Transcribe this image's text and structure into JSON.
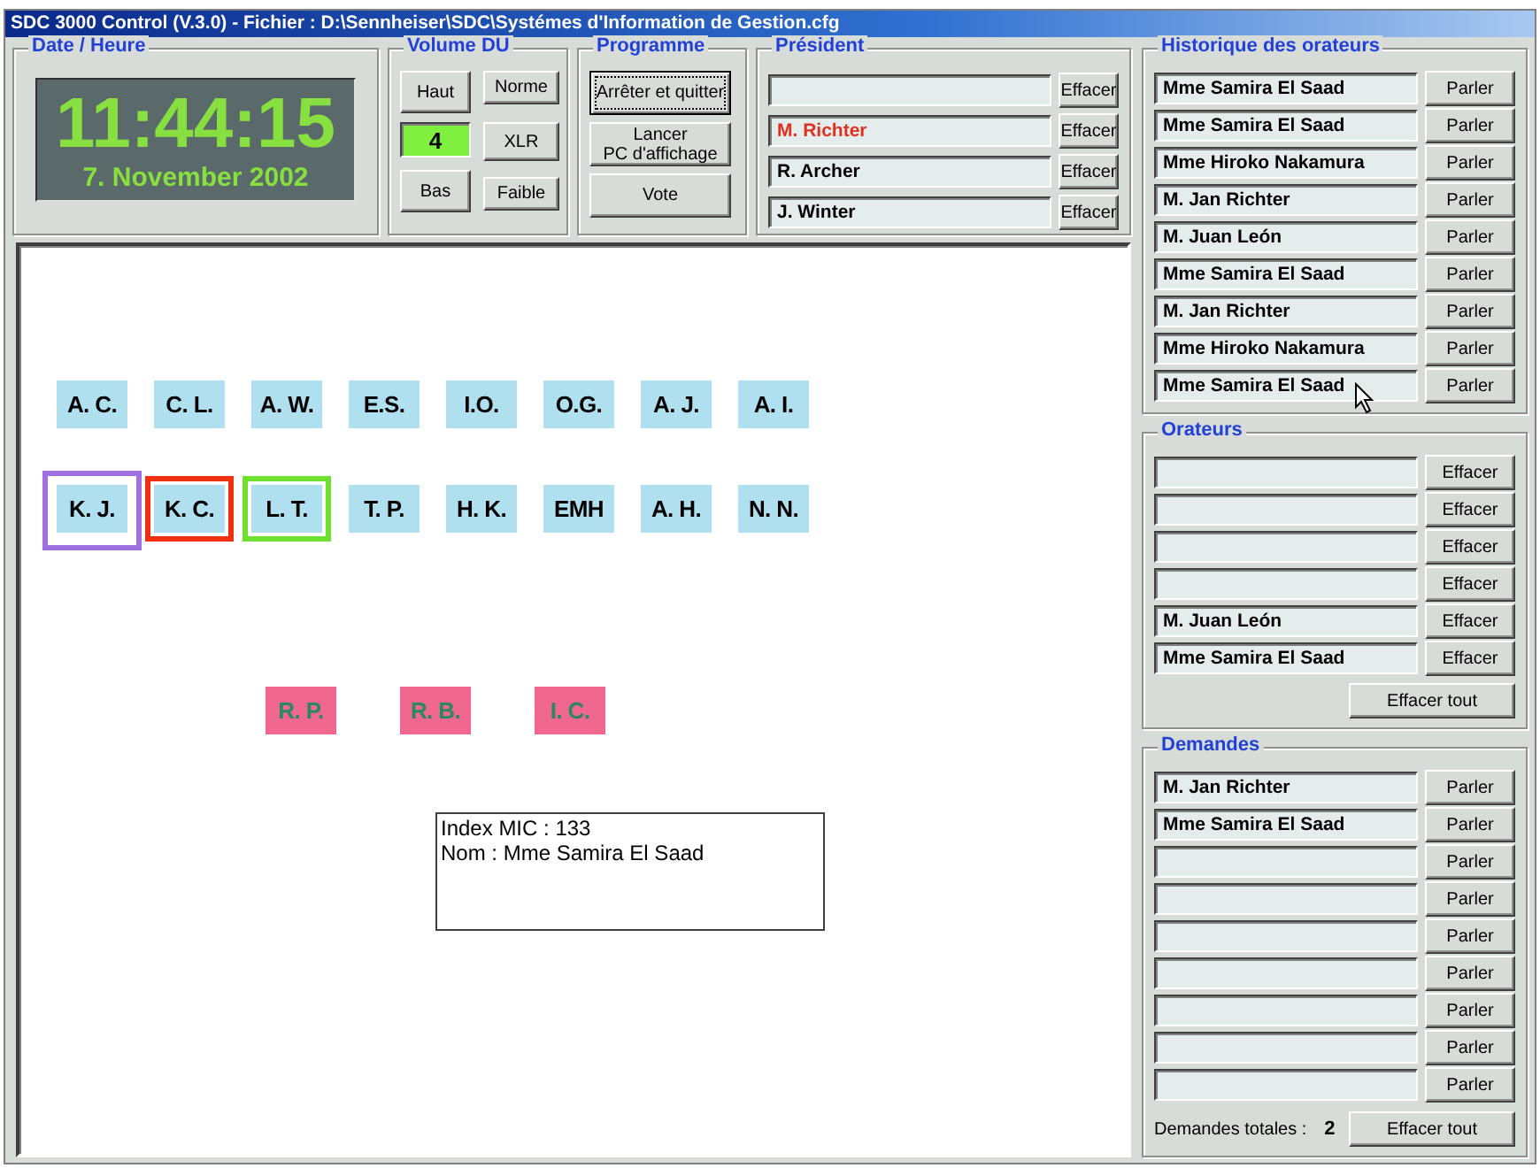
{
  "window": {
    "title": "SDC 3000 Control (V.3.0) - Fichier : D:\\Sennheiser\\SDC\\Systémes d'Information de Gestion.cfg"
  },
  "date_time": {
    "title": "Date / Heure",
    "time": "11:44:15",
    "date": "7. November 2002"
  },
  "volume": {
    "title": "Volume DU",
    "up": "Haut",
    "down": "Bas",
    "value": "4",
    "modes": [
      "Norme",
      "XLR",
      "Faible"
    ]
  },
  "program": {
    "title": "Programme",
    "buttons": [
      {
        "label": "Arrêter et quitter",
        "focused": true
      },
      {
        "label": "Lancer\nPC d'affichage",
        "focused": false
      },
      {
        "label": "Vote",
        "focused": false
      }
    ]
  },
  "president": {
    "title": "Président",
    "rows": [
      {
        "name": "",
        "button": "Effacer"
      },
      {
        "name": "M. Richter",
        "color": "#e03020",
        "button": "Effacer"
      },
      {
        "name": "R. Archer",
        "color": "#000000",
        "button": "Effacer"
      },
      {
        "name": "J. Winter",
        "color": "#000000",
        "button": "Effacer"
      }
    ]
  },
  "mic_rows": [
    {
      "mics": [
        {
          "label": "A. C.",
          "color": "#b0e0f0"
        },
        {
          "label": "C. L.",
          "color": "#b0e0f0"
        },
        {
          "label": "A. W.",
          "color": "#b0e0f0"
        },
        {
          "label": "E.S.",
          "color": "#b0e0f0"
        },
        {
          "label": "I.O.",
          "color": "#b0e0f0"
        },
        {
          "label": "O.G.",
          "color": "#b0e0f0"
        },
        {
          "label": "A. J.",
          "color": "#b0e0f0"
        },
        {
          "label": "A. I.",
          "color": "#b0e0f0"
        }
      ]
    },
    {
      "mics": [
        {
          "label": "K. J.",
          "color": "#b0e0f0",
          "outline": {
            "color": "#a070e0"
          }
        },
        {
          "label": "K. C.",
          "color": "#b0e0f0",
          "outline": {
            "color": "#f03010"
          }
        },
        {
          "label": "L. T.",
          "color": "#b0e0f0",
          "outline": {
            "color": "#70e030"
          }
        },
        {
          "label": "T. P.",
          "color": "#b0e0f0"
        },
        {
          "label": "H. K.",
          "color": "#b0e0f0"
        },
        {
          "label": "EMH",
          "color": "#b0e0f0"
        },
        {
          "label": "A. H.",
          "color": "#b0e0f0"
        },
        {
          "label": "N. N.",
          "color": "#b0e0f0"
        }
      ]
    },
    {
      "mics": [
        {
          "label": "R. P.",
          "color": "#f06890"
        },
        {
          "label": "R. B.",
          "color": "#f06890"
        },
        {
          "label": "I. C.",
          "color": "#f06890"
        }
      ]
    }
  ],
  "info": {
    "lines": [
      "Index MIC : 133",
      "Nom : Mme Samira El Saad"
    ]
  },
  "history": {
    "title": "Historique des orateurs",
    "rows": [
      {
        "name": "Mme Samira El Saad",
        "button": "Parler"
      },
      {
        "name": "Mme Samira El Saad",
        "button": "Parler"
      },
      {
        "name": "Mme Hiroko Nakamura",
        "button": "Parler"
      },
      {
        "name": "M. Jan Richter",
        "button": "Parler"
      },
      {
        "name": "M. Juan León",
        "button": "Parler"
      },
      {
        "name": "Mme Samira El Saad",
        "button": "Parler"
      },
      {
        "name": "M. Jan Richter",
        "button": "Parler"
      },
      {
        "name": "Mme Hiroko Nakamura",
        "button": "Parler"
      },
      {
        "name": "Mme Samira El Saad",
        "button": "Parler"
      }
    ]
  },
  "speakers": {
    "title": "Orateurs",
    "rows": [
      {
        "name": "",
        "button": "Effacer"
      },
      {
        "name": "",
        "button": "Effacer"
      },
      {
        "name": "",
        "button": "Effacer"
      },
      {
        "name": "",
        "button": "Effacer"
      },
      {
        "name": "M. Juan León",
        "button": "Effacer"
      },
      {
        "name": "Mme Samira El Saad",
        "button": "Effacer"
      }
    ],
    "clear_all": "Effacer tout"
  },
  "requests": {
    "title": "Demandes",
    "rows": [
      {
        "name": "M. Jan Richter",
        "button": "Parler"
      },
      {
        "name": "Mme Samira El Saad",
        "button": "Parler"
      },
      {
        "name": "",
        "button": "Parler"
      },
      {
        "name": "",
        "button": "Parler"
      },
      {
        "name": "",
        "button": "Parler"
      },
      {
        "name": "",
        "button": "Parler"
      },
      {
        "name": "",
        "button": "Parler"
      },
      {
        "name": "",
        "button": "Parler"
      },
      {
        "name": "",
        "button": "Parler"
      }
    ],
    "total_label": "Demandes totales :",
    "total": "2",
    "clear_all": "Effacer tout"
  }
}
